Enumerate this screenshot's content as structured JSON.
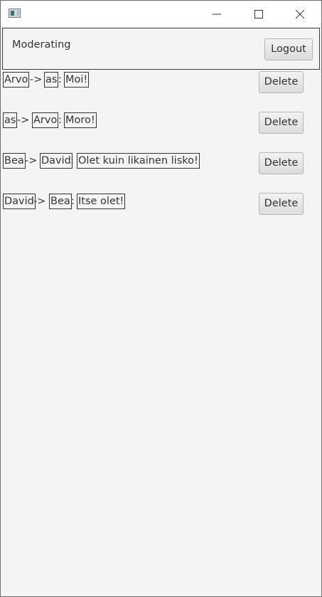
{
  "window": {
    "icon": "app-window-icon",
    "controls": [
      "minimize-icon",
      "maximize-icon",
      "close-icon"
    ]
  },
  "header": {
    "title": "Moderating",
    "logout_label": "Logout"
  },
  "messages": [
    {
      "from": "Arvo",
      "arrow": "->",
      "to": "as",
      "colon": ":",
      "text": "Moi!",
      "delete_label": "Delete"
    },
    {
      "from": "as",
      "arrow": "->",
      "to": "Arvo",
      "colon": ":",
      "text": "Moro!",
      "delete_label": "Delete"
    },
    {
      "from": "Bea",
      "arrow": "->",
      "to": "David",
      "colon": ":",
      "text": "Olet kuin likainen lisko!",
      "delete_label": "Delete"
    },
    {
      "from": "David",
      "arrow": "->",
      "to": "Bea",
      "colon": ":",
      "text": "Itse olet!",
      "delete_label": "Delete"
    }
  ]
}
